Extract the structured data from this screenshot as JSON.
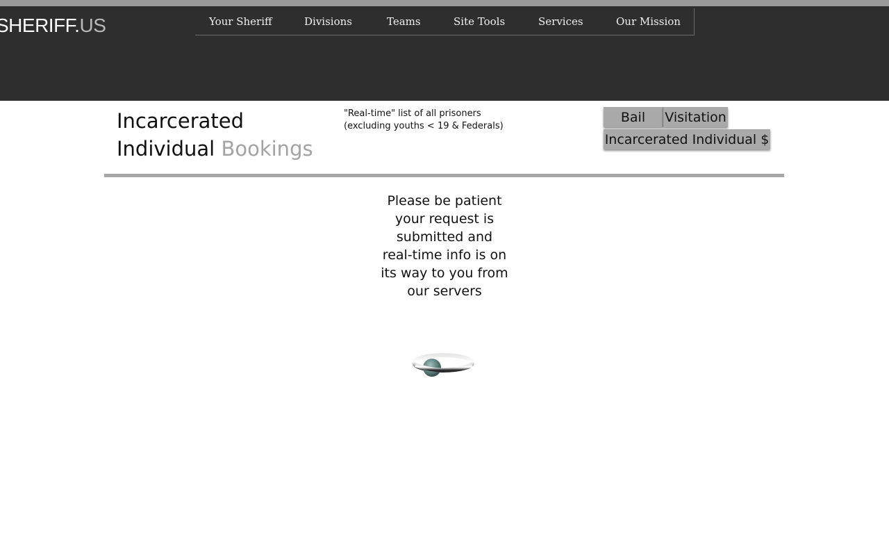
{
  "brand": {
    "logo_main": "SHERIFF.",
    "logo_suffix": "US"
  },
  "nav": {
    "items": [
      "Your Sheriff",
      "Divisions",
      "Teams",
      "Site Tools",
      "Services",
      "Our Mission"
    ]
  },
  "page": {
    "title_line1": "Incarcerated",
    "title_line2_a": "Individual",
    "title_line2_b": "Bookings",
    "subtitle_line1": "\"Real-time\" list of all prisoners",
    "subtitle_line2": "(excluding youths <  19 & Federals)"
  },
  "buttons": {
    "bail": "Bail",
    "visitation": "Visitation",
    "amount": "Incarcerated Individual $"
  },
  "loading": {
    "lines": [
      "Please be patient",
      "your request is",
      "submitted and",
      "real-time info is on",
      "its way to you from",
      "our servers"
    ],
    "icon": "loading-spinner-icon"
  },
  "colors": {
    "header_bg": "#2e2e2e",
    "accent_gray": "#a9a9a9",
    "muted_text": "#a3a3a3"
  }
}
